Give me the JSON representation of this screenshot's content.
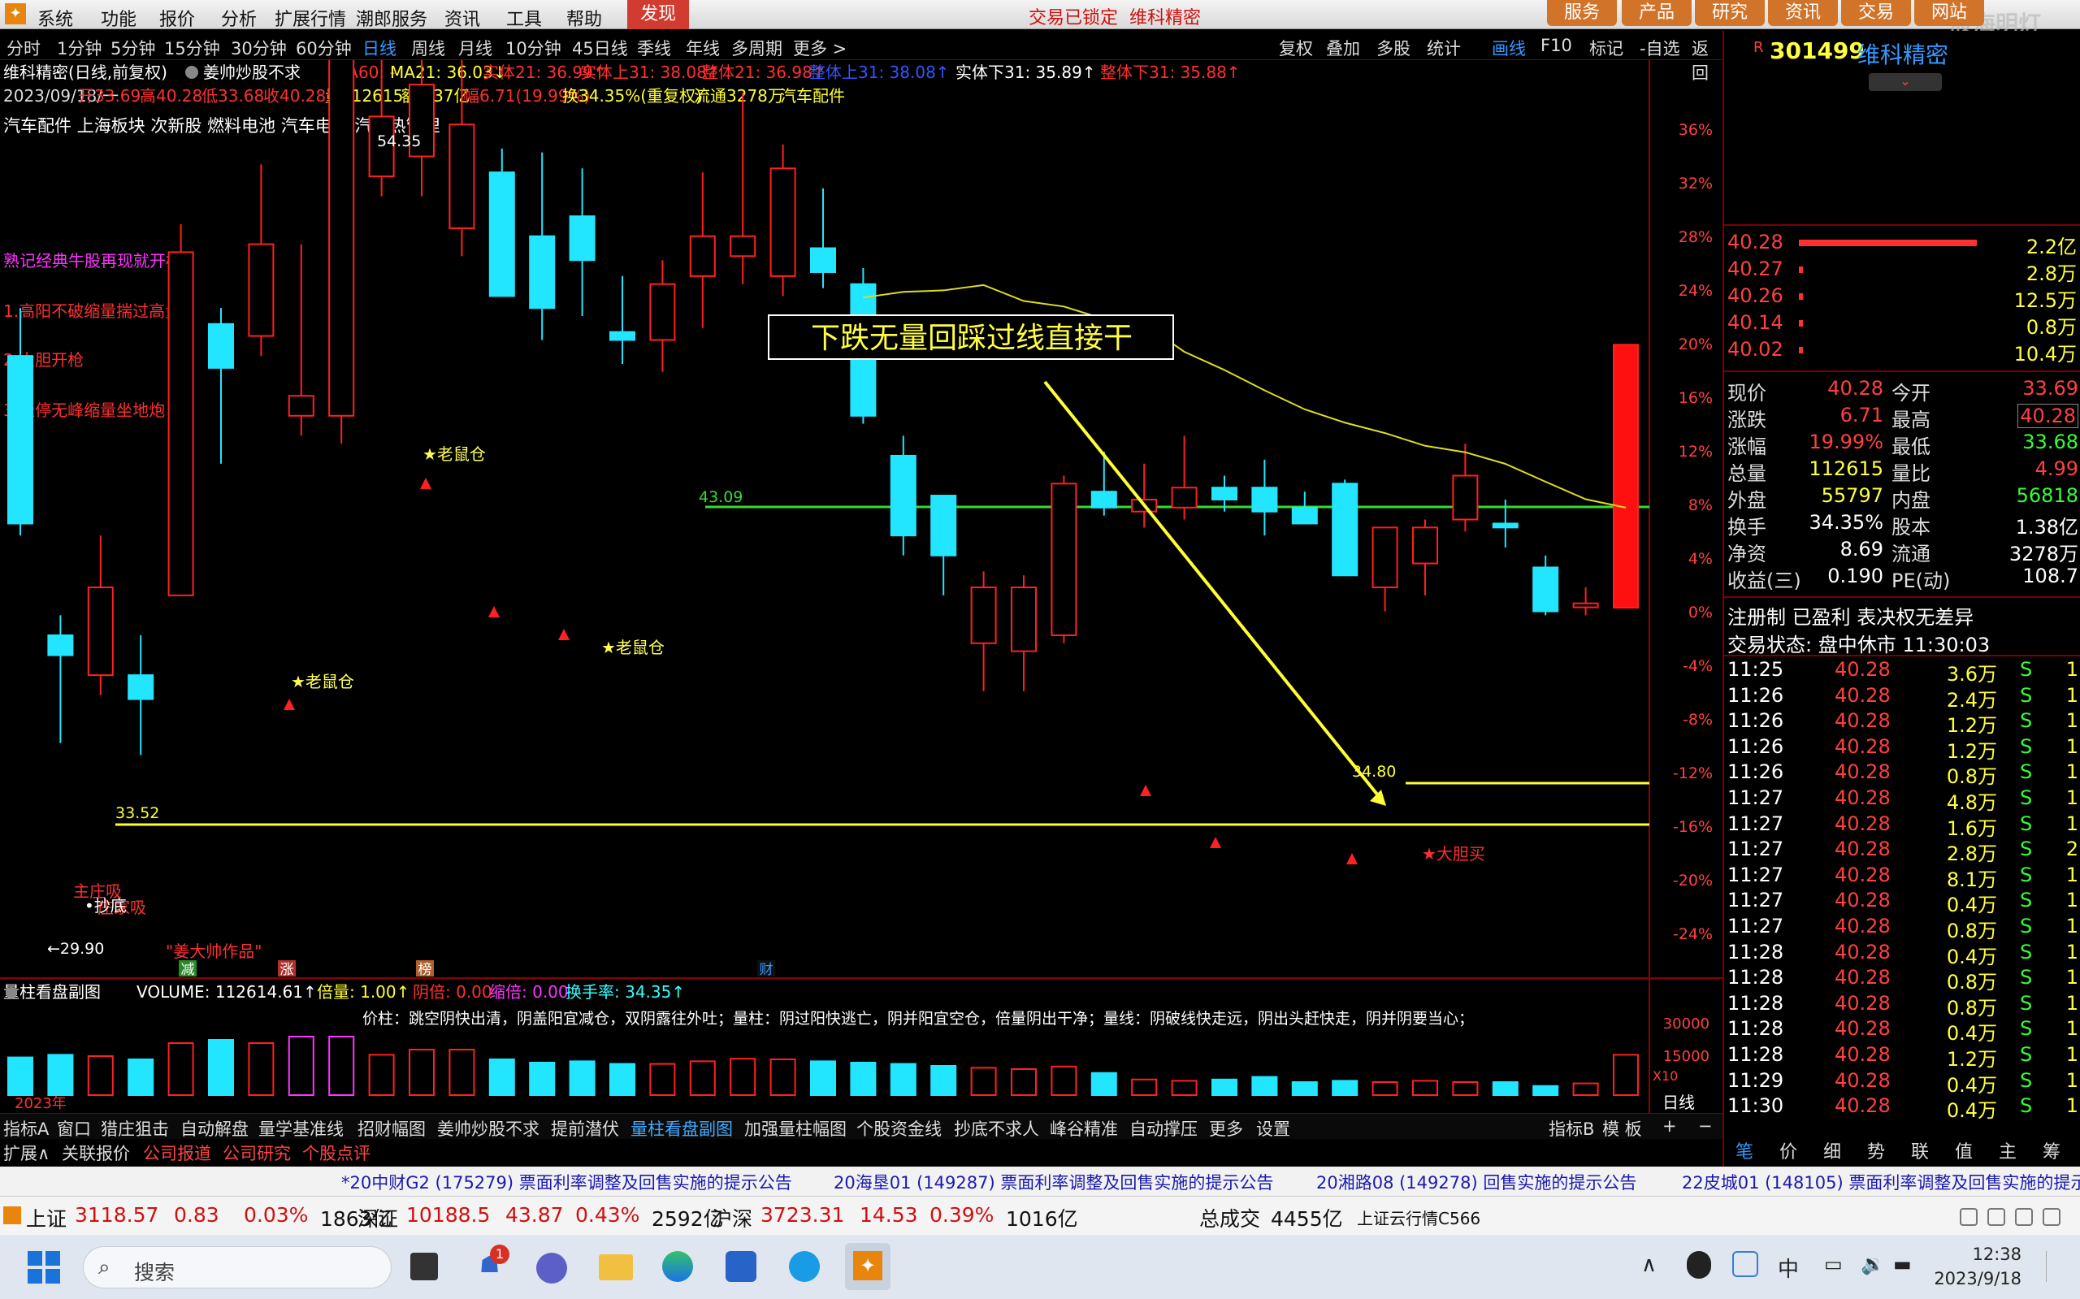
{
  "menubar": {
    "items": [
      "系统",
      "功能",
      "报价",
      "分析",
      "扩展行情",
      "潮郎服务",
      "资讯",
      "工具",
      "帮助"
    ],
    "discover": "发现",
    "center_text": "交易已锁定",
    "center_stock": "维科精密",
    "right_buttons": [
      "服务",
      "产品",
      "研究",
      "资讯",
      "交易",
      "网站"
    ],
    "watermark": "股海明灯"
  },
  "tabs": [
    "分时",
    "1分钟",
    "5分钟",
    "15分钟",
    "30分钟",
    "60分钟",
    "日线",
    "周线",
    "月线",
    "10分钟",
    "45日线",
    "季线",
    "年线",
    "多周期",
    "更多 >"
  ],
  "active_tab": "日线",
  "toolbar_right": [
    "复权",
    "叠加",
    "多股",
    "统计",
    "画线",
    "F10",
    "标记",
    "-自选",
    "返回"
  ],
  "toolbar_active": "画线",
  "chart": {
    "header_name": "维科精密(日线,前复权)",
    "header_indicator": "姜帅炒股不求",
    "ma_labels": [
      {
        "text": "MA60: -",
        "color": "#ff3030"
      },
      {
        "text": "MA21: 36.03↓",
        "color": "#ffff33"
      },
      {
        "text": "实体21: 36.99↑",
        "color": "#ff3030"
      },
      {
        "text": "实体上31: 38.08↑",
        "color": "#ff3030"
      },
      {
        "text": "整体21: 36.98↑",
        "color": "#ff3030"
      },
      {
        "text": "整体上31: 38.08↑",
        "color": "#3355ff"
      },
      {
        "text": "实体下31: 35.89↑",
        "color": "#ffffff"
      },
      {
        "text": "整体下31: 35.88↑",
        "color": "#ff3030"
      }
    ],
    "info_line": [
      {
        "text": "2023/09/18/一",
        "color": "#dddddd"
      },
      {
        "text": "开33.69",
        "color": "#ff3030"
      },
      {
        "text": "高40.28",
        "color": "#ff3030"
      },
      {
        "text": "低33.68",
        "color": "#ff3030"
      },
      {
        "text": "收40.28",
        "color": "#ff3030"
      },
      {
        "text": "量112615",
        "color": "#ffff33"
      },
      {
        "text": "额4.37亿",
        "color": "#ffff33"
      },
      {
        "text": "幅6.71(19.99%)",
        "color": "#ff3030"
      },
      {
        "text": "换34.35%(重复权)",
        "color": "#ffff33"
      },
      {
        "text": "流通3278万",
        "color": "#ffff33"
      },
      {
        "text": "汽车配件",
        "color": "#ffff33"
      }
    ],
    "sectors": "汽车配件  上海板块  次新股 燃料电池 汽车电子 汽车热管理",
    "left_notes": [
      {
        "text": "熟记经典牛股再现就开枪",
        "color": "#ff33ff"
      },
      {
        "text": "1.高阳不破缩量揣过高量",
        "color": "#ff3030"
      },
      {
        "text": "2.大胆开枪",
        "color": "#ff3030"
      },
      {
        "text": "3.涨停无峰缩量坐地炮",
        "color": "#ff3030"
      }
    ],
    "title_box": "下跌无量回踩过线直接干",
    "pct_labels": [
      "36%",
      "32%",
      "28%",
      "24%",
      "20%",
      "16%",
      "12%",
      "8%",
      "4%",
      "0%",
      "-4%",
      "-8%",
      "-12%",
      "-16%",
      "-20%",
      "-24%"
    ],
    "levels": {
      "green": "43.09",
      "yellow_low": "33.52",
      "yellow_high": "34.80"
    },
    "high_label": "54.35",
    "low_label": "←29.90",
    "signals": [
      {
        "text": "★老鼠仓",
        "color": "#ffff55"
      },
      {
        "text": "★老鼠仓",
        "color": "#ffff55"
      },
      {
        "text": "★老鼠仓",
        "color": "#ffff55"
      },
      {
        "text": "主庄吸",
        "color": "#ff3030"
      },
      {
        "text": "庄家吸",
        "color": "#ff3030"
      },
      {
        "text": "★大胆买",
        "color": "#ff3030"
      },
      {
        "text": "•抄底",
        "color": "#ffffff"
      }
    ],
    "author": "\"姜大帅作品\"",
    "markers": [
      "减",
      "涨",
      "榜",
      "财"
    ],
    "year_label": "2023年"
  },
  "chart_data": {
    "type": "candlestick",
    "title": "维科精密(日线,前复权)",
    "dates": [
      "",
      "",
      "",
      "",
      "",
      "",
      "",
      "",
      "",
      "",
      "",
      "",
      "",
      "",
      "",
      "",
      "",
      "",
      "",
      "",
      "",
      "",
      "",
      "",
      "",
      "",
      "",
      "",
      "",
      "",
      "",
      "",
      "",
      "",
      "",
      "",
      "",
      "",
      "",
      "",
      "",
      "",
      "",
      ""
    ],
    "candles": [
      [
        40.0,
        41.2,
        35.5,
        35.8
      ],
      [
        33.0,
        33.5,
        30.3,
        32.5
      ],
      [
        32.0,
        35.5,
        31.5,
        34.2
      ],
      [
        32.0,
        33.0,
        30.0,
        31.4
      ],
      [
        34.0,
        43.3,
        34.0,
        42.6
      ],
      [
        40.8,
        41.2,
        37.3,
        39.7
      ],
      [
        40.5,
        44.8,
        40.0,
        42.8
      ],
      [
        38.5,
        42.8,
        38.0,
        39.0
      ],
      [
        38.5,
        54.4,
        37.8,
        51.3
      ],
      [
        44.5,
        49.0,
        44.0,
        46.0
      ],
      [
        45.0,
        48.0,
        44.0,
        46.8
      ],
      [
        43.2,
        47.6,
        42.5,
        45.8
      ],
      [
        44.6,
        45.2,
        41.8,
        41.5
      ],
      [
        43.0,
        45.1,
        40.4,
        41.2
      ],
      [
        43.5,
        44.7,
        41.0,
        42.4
      ],
      [
        40.6,
        42.0,
        39.8,
        40.4
      ],
      [
        40.4,
        42.4,
        39.6,
        41.8
      ],
      [
        42.0,
        44.6,
        40.7,
        43.0
      ],
      [
        42.5,
        46.6,
        41.8,
        43.0
      ],
      [
        42.0,
        45.3,
        41.5,
        44.7
      ],
      [
        42.7,
        44.2,
        41.7,
        42.1
      ],
      [
        41.8,
        42.2,
        38.3,
        38.5
      ],
      [
        37.5,
        38.0,
        35.0,
        35.5
      ],
      [
        36.5,
        36.5,
        34.0,
        35.0
      ],
      [
        32.8,
        34.6,
        31.6,
        34.2
      ],
      [
        32.6,
        34.5,
        31.6,
        34.2
      ],
      [
        33.0,
        37.0,
        32.8,
        36.8
      ],
      [
        36.6,
        37.6,
        36.0,
        36.2
      ],
      [
        36.1,
        37.3,
        35.7,
        36.4
      ],
      [
        36.2,
        38.0,
        35.9,
        36.7
      ],
      [
        36.7,
        37.0,
        36.1,
        36.4
      ],
      [
        36.7,
        37.4,
        35.5,
        36.1
      ],
      [
        36.2,
        36.6,
        35.8,
        35.8
      ],
      [
        36.8,
        36.9,
        34.5,
        34.5
      ],
      [
        34.2,
        35.7,
        33.6,
        35.7
      ],
      [
        34.8,
        35.9,
        34.0,
        35.7
      ],
      [
        35.9,
        37.8,
        35.6,
        37.0
      ],
      [
        35.8,
        36.4,
        35.2,
        35.7
      ],
      [
        34.7,
        35.0,
        33.5,
        33.6
      ],
      [
        33.7,
        34.2,
        33.5,
        33.8
      ],
      [
        33.69,
        40.28,
        33.68,
        40.28
      ]
    ],
    "volume_ticks": [
      "30000",
      "15000"
    ],
    "ylim_pct": [
      -24,
      36
    ]
  },
  "volume_panel": {
    "title": "量柱看盘副图",
    "volume": "VOLUME: 112614.61↑",
    "labels": [
      {
        "text": "倍量: 1.00↑",
        "color": "#ffff33"
      },
      {
        "text": "阴倍: 0.00",
        "color": "#ff3030"
      },
      {
        "text": "缩倍: 0.00",
        "color": "#ff33ff"
      },
      {
        "text": "换手率: 34.35↑",
        "color": "#33ffff"
      }
    ],
    "desc": "价柱：跳空阴快出清，阴盖阳宜减仓，双阴露往外吐；量柱：阴过阳快逃亡，阴并阳宜空仓，倍量阴出干净；量线：阴破线快走远，阴出头赶快走，阴并阴要当心；",
    "x_label": "X10",
    "day_label": "日线",
    "marks": [
      "P",
      "P",
      "3",
      "3",
      "!",
      "换"
    ]
  },
  "bottom_tabs": [
    "指标A",
    "窗口",
    "猎庄狙击",
    "自动解盘",
    "量学基准线",
    "招财幅图",
    "姜帅炒股不求",
    "提前潜伏",
    "量柱看盘副图",
    "加强量柱幅图",
    "个股资金线",
    "抄底不求人",
    "峰谷精准",
    "自动撑压",
    "更多",
    "设置"
  ],
  "bottom_active": "量柱看盘副图",
  "bottom_right": [
    "指标B",
    "模 板",
    "+",
    "−"
  ],
  "sub_tabs": [
    "扩展∧",
    "关联报价",
    "公司报道",
    "公司研究",
    "个股点评"
  ],
  "right_panel": {
    "code": "301499",
    "name": "维科精密",
    "prefix": "R",
    "order_book": [
      {
        "price": "40.28",
        "vol": "2.2亿",
        "bar": 0.92
      },
      {
        "price": "40.27",
        "vol": "2.8万",
        "bar": 0.02
      },
      {
        "price": "40.26",
        "vol": "12.5万",
        "bar": 0.02
      },
      {
        "price": "40.14",
        "vol": "0.8万",
        "bar": 0.02
      },
      {
        "price": "40.02",
        "vol": "10.4万",
        "bar": 0.02
      }
    ],
    "stats": [
      [
        "现价",
        "40.28",
        "今开",
        "33.69"
      ],
      [
        "涨跌",
        "6.71",
        "最高",
        "40.28"
      ],
      [
        "涨幅",
        "19.99%",
        "最低",
        "33.68"
      ],
      [
        "总量",
        "112615",
        "量比",
        "4.99"
      ],
      [
        "外盘",
        "55797",
        "内盘",
        "56818"
      ],
      [
        "换手",
        "34.35%",
        "股本",
        "1.38亿"
      ],
      [
        "净资",
        "8.69",
        "流通",
        "3278万"
      ],
      [
        "收益(三)",
        "0.190",
        "PE(动)",
        "108.7"
      ]
    ],
    "reg": "注册制 已盈利 表决权无差异",
    "state": "交易状态: 盘中休市 11:30:03",
    "ticks": [
      [
        "11:25",
        "40.28",
        "3.6万",
        "S",
        "1"
      ],
      [
        "11:26",
        "40.28",
        "2.4万",
        "S",
        "1"
      ],
      [
        "11:26",
        "40.28",
        "1.2万",
        "S",
        "1"
      ],
      [
        "11:26",
        "40.28",
        "1.2万",
        "S",
        "1"
      ],
      [
        "11:26",
        "40.28",
        "0.8万",
        "S",
        "1"
      ],
      [
        "11:27",
        "40.28",
        "4.8万",
        "S",
        "1"
      ],
      [
        "11:27",
        "40.28",
        "1.6万",
        "S",
        "1"
      ],
      [
        "11:27",
        "40.28",
        "2.8万",
        "S",
        "2"
      ],
      [
        "11:27",
        "40.28",
        "8.1万",
        "S",
        "1"
      ],
      [
        "11:27",
        "40.28",
        "0.4万",
        "S",
        "1"
      ],
      [
        "11:27",
        "40.28",
        "0.8万",
        "S",
        "1"
      ],
      [
        "11:28",
        "40.28",
        "0.4万",
        "S",
        "1"
      ],
      [
        "11:28",
        "40.28",
        "0.8万",
        "S",
        "1"
      ],
      [
        "11:28",
        "40.28",
        "0.8万",
        "S",
        "1"
      ],
      [
        "11:28",
        "40.28",
        "0.4万",
        "S",
        "1"
      ],
      [
        "11:28",
        "40.28",
        "1.2万",
        "S",
        "1"
      ],
      [
        "11:29",
        "40.28",
        "0.4万",
        "S",
        "1"
      ],
      [
        "11:30",
        "40.28",
        "0.4万",
        "S",
        "1"
      ]
    ],
    "bottom_tabs": [
      "笔",
      "价",
      "细",
      "势",
      "联",
      "值",
      "主",
      "筹"
    ]
  },
  "news": [
    "*20中财G2 (175279) 票面利率调整及回售实施的提示公告",
    "20海垦01 (149287) 票面利率调整及回售实施的提示公告",
    "20湘路08 (149278) 回售实施的提示公告",
    "22皮城01 (148105) 票面利率调整及回售实施的提示公"
  ],
  "indices": [
    {
      "name": "上证",
      "val": "3118.57",
      "chg": "0.83",
      "pct": "0.03%",
      "amt": "1863亿"
    },
    {
      "name": "深证",
      "val": "10188.5",
      "chg": "43.87",
      "pct": "0.43%",
      "amt": "2592亿"
    },
    {
      "name": "沪深",
      "val": "3723.31",
      "chg": "14.53",
      "pct": "0.39%",
      "amt": "1016亿"
    }
  ],
  "total_label": "总成交",
  "total_val": "4455亿",
  "server": "上证云行情C566",
  "taskbar": {
    "search": "搜索",
    "badge": "1",
    "time": "12:38",
    "date": "2023/9/18",
    "lang": "中"
  }
}
